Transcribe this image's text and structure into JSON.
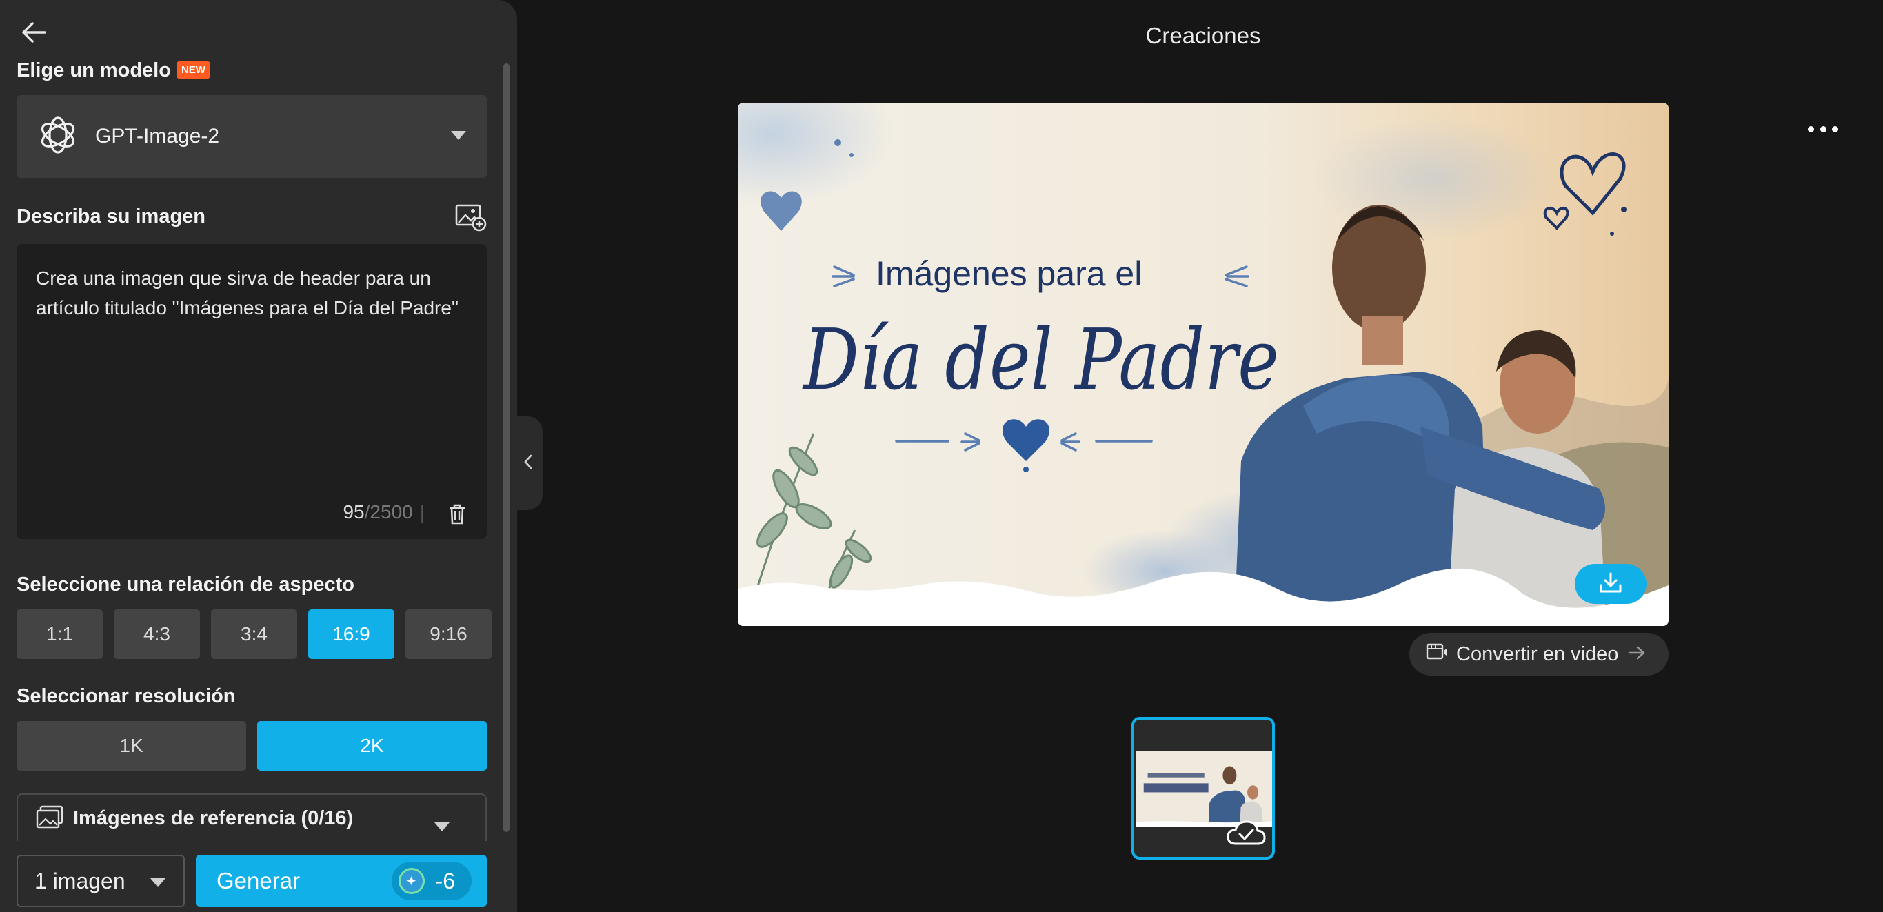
{
  "panel": {
    "model_section": {
      "title": "Elige un modelo",
      "badge": "NEW",
      "selected_model": "GPT-Image-2"
    },
    "describe_section": {
      "title": "Describa su imagen",
      "prompt_text": "Crea una imagen que sirva de header para un artículo titulado \"Imágenes para el Día del Padre\"",
      "char_count": "95",
      "char_max": "/2500",
      "divider": "|"
    },
    "aspect_section": {
      "title": "Seleccione una relación de aspecto",
      "options": [
        "1:1",
        "4:3",
        "3:4",
        "16:9",
        "9:16"
      ],
      "selected": "16:9"
    },
    "resolution_section": {
      "title": "Seleccionar resolución",
      "options": [
        "1K",
        "2K"
      ],
      "selected": "2K"
    },
    "reference_section": {
      "label": "Imágenes de referencia (0/16)"
    },
    "count_select": {
      "value": "1 imagen"
    },
    "generate": {
      "label": "Generar",
      "cost": "-6"
    }
  },
  "main": {
    "title": "Creaciones",
    "preview": {
      "line1": "Imágenes para el",
      "line2": "Día del Padre"
    },
    "convert_label": "Convertir en video"
  },
  "colors": {
    "accent": "#11b0e8",
    "panel_bg": "#2b2b2b",
    "page_bg": "#161616",
    "new_badge": "#ff5a1f",
    "ink_navy": "#1f3566"
  },
  "icons": [
    "back-arrow-icon",
    "openai-logo-icon",
    "image-add-icon",
    "trash-icon",
    "gallery-icon",
    "chevron-left-icon",
    "more-dots-icon",
    "download-icon",
    "video-convert-icon",
    "arrow-right-icon",
    "cloud-check-icon",
    "sparkle-credit-icon"
  ]
}
